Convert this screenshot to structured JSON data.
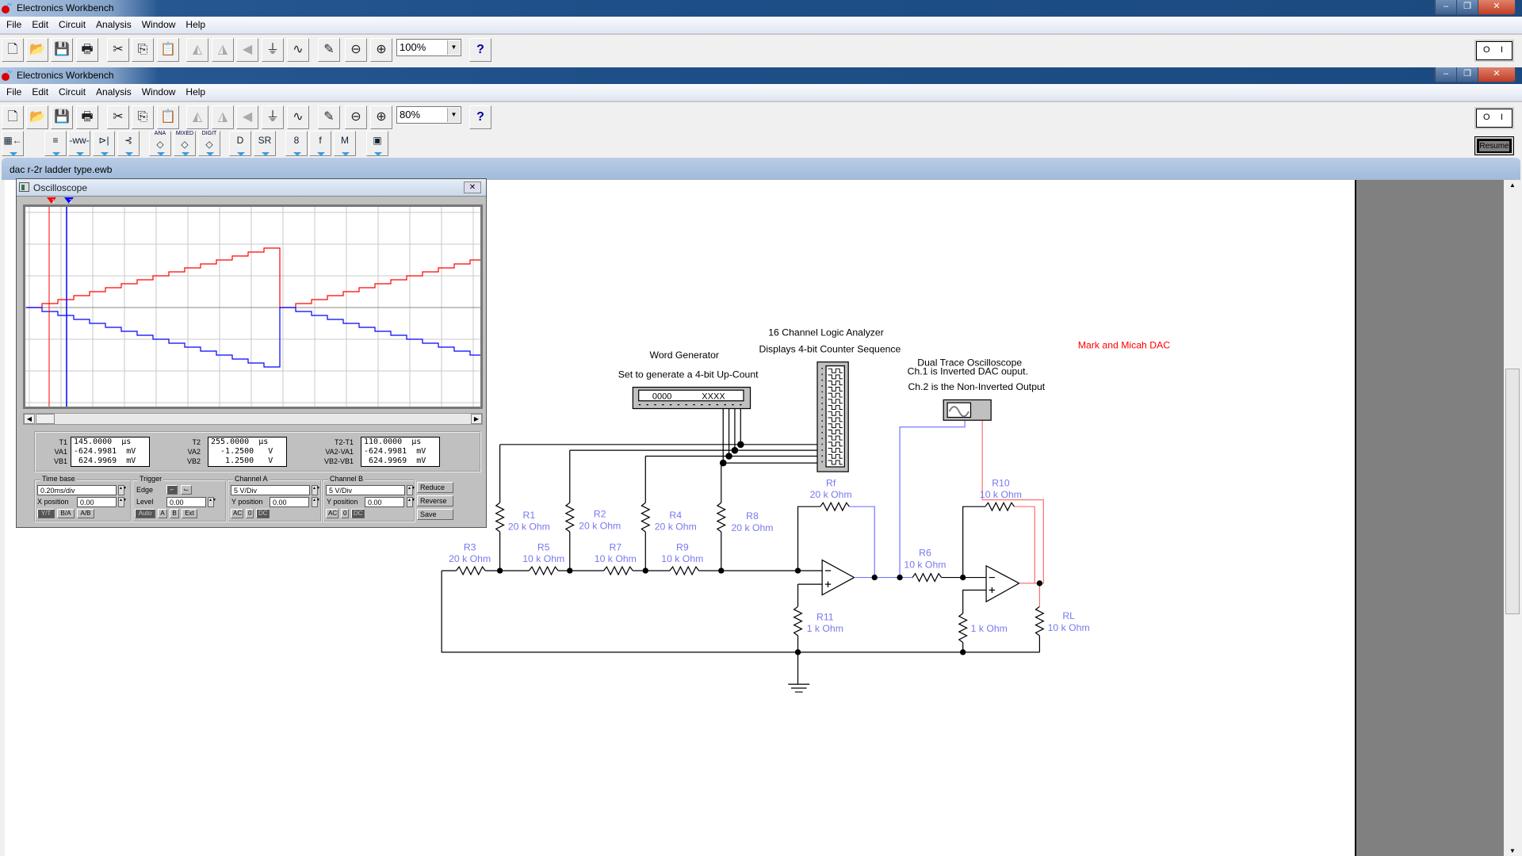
{
  "app": {
    "title": "Electronics Workbench"
  },
  "menu": [
    "File",
    "Edit",
    "Circuit",
    "Analysis",
    "Window",
    "Help"
  ],
  "window_buttons": {
    "minimize": "–",
    "restore": "❐",
    "close": "✕"
  },
  "toolbar": {
    "buttons": [
      {
        "name": "new",
        "glyph": "🗋"
      },
      {
        "name": "open",
        "glyph": "📂"
      },
      {
        "name": "save",
        "glyph": "💾"
      },
      {
        "name": "print",
        "glyph": "🖶"
      },
      {
        "name": "cut",
        "glyph": "✂"
      },
      {
        "name": "copy",
        "glyph": "⎘"
      },
      {
        "name": "paste",
        "glyph": "📋"
      },
      {
        "name": "rotate",
        "glyph": "◭"
      },
      {
        "name": "flip-horizontal",
        "glyph": "◮"
      },
      {
        "name": "flip-vertical",
        "glyph": "◀"
      },
      {
        "name": "component-properties",
        "glyph": "⏚"
      },
      {
        "name": "create-subcircuit",
        "glyph": "∿"
      },
      {
        "name": "analysis-graphs",
        "glyph": "✎"
      },
      {
        "name": "zoom-out",
        "glyph": "⊖"
      },
      {
        "name": "zoom-in",
        "glyph": "⊕"
      }
    ],
    "zoom_top": "100%",
    "zoom_main": "80%",
    "help": "?"
  },
  "parts": [
    {
      "name": "favorites",
      "glyph": "▦←",
      "label": ""
    },
    {
      "name": "sources",
      "glyph": "≡",
      "label": ""
    },
    {
      "name": "basic",
      "glyph": "-ww-",
      "label": ""
    },
    {
      "name": "diodes",
      "glyph": "⊳|",
      "label": ""
    },
    {
      "name": "transistors",
      "glyph": "⊰",
      "label": ""
    },
    {
      "name": "analog-ics",
      "glyph": "◇",
      "label": "ANA"
    },
    {
      "name": "mixed-ics",
      "glyph": "◇",
      "label": "MIXED"
    },
    {
      "name": "digital-ics",
      "glyph": "◇",
      "label": "DIGIT"
    },
    {
      "name": "logic-gates",
      "glyph": "D",
      "label": ""
    },
    {
      "name": "digital",
      "glyph": "SR",
      "label": ""
    },
    {
      "name": "indicators",
      "glyph": "8",
      "label": ""
    },
    {
      "name": "controls",
      "glyph": "f",
      "label": ""
    },
    {
      "name": "miscellaneous",
      "glyph": "M",
      "label": ""
    },
    {
      "name": "instruments",
      "glyph": "▣",
      "label": ""
    }
  ],
  "power_switch": {
    "off": "O",
    "on": "I"
  },
  "resume_label": "Resume",
  "document": {
    "title": "dac r-2r ladder type.ewb"
  },
  "oscilloscope": {
    "title": "Oscilloscope",
    "close": "✕",
    "cursor1": "1",
    "cursor2": "2",
    "readouts": {
      "col1": {
        "labels": [
          "T1",
          "VA1",
          "VB1"
        ],
        "values": [
          "145.0000  µs",
          "-624.9981  mV",
          " 624.9969  mV"
        ]
      },
      "col2": {
        "labels": [
          "T2",
          "VA2",
          "VB2"
        ],
        "values": [
          "255.0000  µs",
          "  -1.2500   V",
          "   1.2500   V"
        ]
      },
      "col3": {
        "labels": [
          "T2-T1",
          "VA2-VA1",
          "VB2-VB1"
        ],
        "values": [
          "110.0000  µs",
          "-624.9981  mV",
          " 624.9969  mV"
        ]
      }
    },
    "timebase": {
      "label": "Time base",
      "value": "0.20ms/div",
      "xpos_label": "X position",
      "xpos": "0.00",
      "modes": [
        "Y/T",
        "B/A",
        "A/B"
      ],
      "active_mode": "Y/T"
    },
    "trigger": {
      "label": "Trigger",
      "edge_label": "Edge",
      "level_label": "Level",
      "level": "0.00",
      "rising": "⌐",
      "falling": "⌙",
      "sources": [
        "Auto",
        "A",
        "B",
        "Ext"
      ],
      "active_source": "Auto"
    },
    "channel_a": {
      "label": "Channel A",
      "scale": "5 V/Div",
      "ypos_label": "Y position",
      "ypos": "0.00",
      "coupling": [
        "AC",
        "0",
        "DC"
      ],
      "active": "DC"
    },
    "channel_b": {
      "label": "Channel B",
      "scale": "5 V/Div",
      "ypos_label": "Y position",
      "ypos": "0.00",
      "coupling": [
        "AC",
        "0",
        "DC"
      ],
      "active": "DC"
    },
    "buttons": [
      "Reduce",
      "Reverse",
      "Save"
    ]
  },
  "chart_data": {
    "type": "line",
    "x_unit": "ms",
    "timebase_ms_per_div": 0.2,
    "volts_per_div": 5,
    "xlim": [
      0,
      2.9
    ],
    "ylim": [
      -16,
      16
    ],
    "grid": true,
    "step_ms": 0.1,
    "steps_per_period": 16,
    "series": [
      {
        "channel": "A",
        "color": "#ff0000",
        "levels_V": [
          0,
          0.625,
          1.25,
          1.875,
          2.5,
          3.125,
          3.75,
          4.375,
          5,
          5.625,
          6.25,
          6.875,
          7.5,
          8.125,
          8.75,
          9.375
        ]
      },
      {
        "channel": "B",
        "color": "#0000ff",
        "levels_V": [
          0,
          -0.625,
          -1.25,
          -1.875,
          -2.5,
          -3.125,
          -3.75,
          -4.375,
          -5,
          -5.625,
          -6.25,
          -6.875,
          -7.5,
          -8.125,
          -8.75,
          -9.375
        ]
      }
    ],
    "cursors_us": [
      145,
      255
    ]
  },
  "circuit": {
    "word_generator": {
      "title": "Word Generator",
      "note": "Set to generate a 4-bit Up-Count",
      "value": "0000",
      "mask": "XXXX"
    },
    "logic_analyzer": {
      "title": "16 Channel Logic Analyzer",
      "note": "Displays 4-bit Counter Sequence"
    },
    "scope": {
      "title": "Dual Trace Oscilloscope",
      "note1": "Ch.1 is Inverted DAC ouput.",
      "note2": "Ch.2 is the Non-Inverted Output"
    },
    "author_note": "Mark and Micah DAC",
    "resistors": [
      {
        "name": "R1",
        "value": "20 k Ohm"
      },
      {
        "name": "R2",
        "value": "20 k Ohm"
      },
      {
        "name": "R4",
        "value": "20 k Ohm"
      },
      {
        "name": "R8",
        "value": "20 k Ohm"
      },
      {
        "name": "R3",
        "value": "20 k Ohm"
      },
      {
        "name": "R5",
        "value": "10 k Ohm"
      },
      {
        "name": "R7",
        "value": "10 k Ohm"
      },
      {
        "name": "R9",
        "value": "10 k Ohm"
      },
      {
        "name": "Rf",
        "value": "20 k Ohm"
      },
      {
        "name": "R6",
        "value": "10 k Ohm"
      },
      {
        "name": "R10",
        "value": "10 k Ohm"
      },
      {
        "name": "R11",
        "value": "1 k Ohm"
      },
      {
        "name": "",
        "value": "1 k Ohm"
      },
      {
        "name": "RL",
        "value": "10 k Ohm"
      }
    ],
    "colors": {
      "label": "#7878f0",
      "ch1_wire": "#7878ff",
      "ch2_wire": "#ff7070",
      "note": "#ff0000"
    }
  }
}
